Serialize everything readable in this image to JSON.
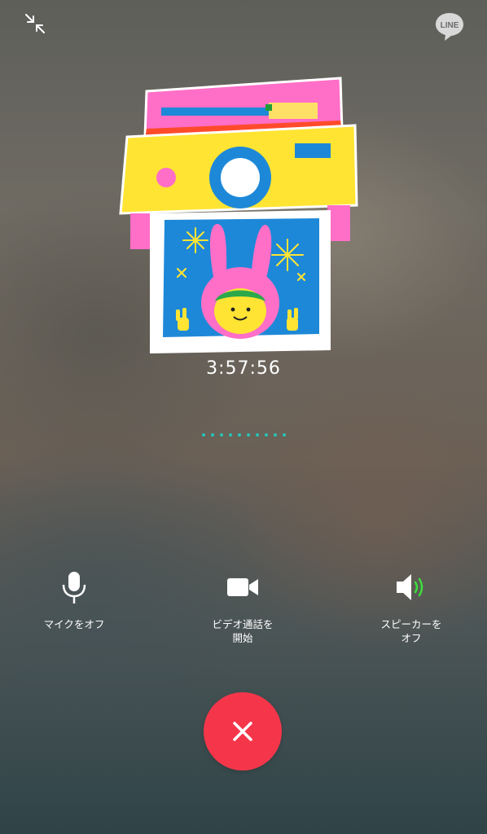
{
  "call": {
    "timer": "3:57:56",
    "brand_logo_text": "LINE",
    "connection_dots": 10
  },
  "controls": {
    "mic_label": "マイクをオフ",
    "video_label": "ビデオ通話を\n開始",
    "speaker_label": "スピーカーを\nオフ"
  },
  "icons": {
    "minimize": "minimize-arrows-icon",
    "logo": "line-logo-icon",
    "mic": "microphone-icon",
    "video": "video-camera-icon",
    "speaker": "speaker-on-icon",
    "end_call": "close-x-icon"
  },
  "colors": {
    "end_call": "#f5364a",
    "speaker_active": "#3ddc3d",
    "dots": "#27c3b6"
  }
}
